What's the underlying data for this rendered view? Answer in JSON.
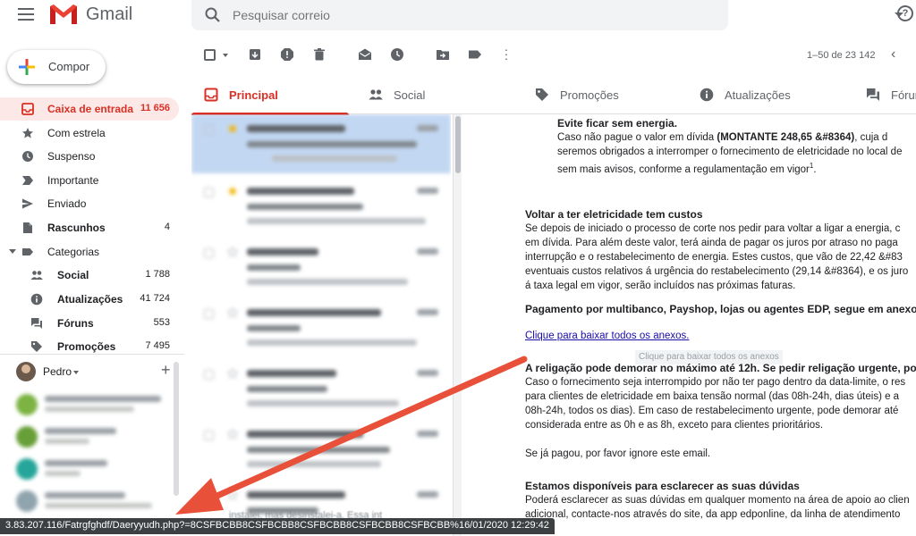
{
  "app": {
    "name": "Gmail"
  },
  "search": {
    "placeholder": "Pesquisar correio"
  },
  "sidebar": {
    "compose_label": "Compor",
    "items": [
      {
        "label": "Caixa de entrada",
        "count": "11 656",
        "icon": "inbox-icon",
        "active": true
      },
      {
        "label": "Com estrela",
        "count": "",
        "icon": "star-icon"
      },
      {
        "label": "Suspenso",
        "count": "",
        "icon": "clock-icon"
      },
      {
        "label": "Importante",
        "count": "",
        "icon": "important-icon"
      },
      {
        "label": "Enviado",
        "count": "",
        "icon": "send-icon"
      },
      {
        "label": "Rascunhos",
        "count": "4",
        "icon": "draft-icon",
        "bold": true
      },
      {
        "label": "Categorias",
        "count": "",
        "icon": "label-icon"
      }
    ],
    "categories": [
      {
        "label": "Social",
        "count": "1 788",
        "icon": "people-icon"
      },
      {
        "label": "Atualizações",
        "count": "41 724",
        "icon": "info-icon"
      },
      {
        "label": "Fóruns",
        "count": "553",
        "icon": "forum-icon"
      },
      {
        "label": "Promoções",
        "count": "7 495",
        "icon": "tag-icon"
      }
    ],
    "user": {
      "name": "Pedro"
    }
  },
  "toolbar": {
    "pager": "1–50 de 23 142"
  },
  "tabs": [
    {
      "label": "Principal",
      "icon": "inbox-icon",
      "active": true
    },
    {
      "label": "Social",
      "icon": "people-icon"
    },
    {
      "label": "Promoções",
      "icon": "tag-icon"
    },
    {
      "label": "Atualizações",
      "icon": "info-icon"
    },
    {
      "label": "Fóruns",
      "icon": "forum-icon"
    }
  ],
  "list": {
    "bottom_text": "instalei, mas desinstalei-a. Essa int"
  },
  "email": {
    "p1_title": "Evite ficar sem energia.",
    "p1_l1a": "Caso não pague o valor em dívida ",
    "p1_l1b": "(MONTANTE 248,65 &#8364)",
    "p1_l1c": ", cuja d",
    "p1_l2": "seremos obrigados a interromper o fornecimento de eletricidade no local de",
    "p1_l3": "sem mais avisos, conforme a regulamentação em vigor",
    "p1_sup": "1",
    "p2_title": "Voltar a ter eletricidade tem custos",
    "p2_l1": "Se depois de iniciado o processo de corte nos pedir para voltar a ligar a energia, c",
    "p2_l2": "em dívida. Para além deste valor, terá ainda de pagar os juros por atraso no paga",
    "p2_l3": "interrupção e o restabelecimento de energia. Estes custos, que vão de 22,42 &#83",
    "p2_l4": "eventuais custos relativos á urgência do restabelecimento (29,14 &#8364), e os juro",
    "p2_l5": "á taxa legal em vigor, serão incluídos nas próximas faturas.",
    "p3_title": "Pagamento por multibanco, Payshop, lojas ou agentes EDP, segue em anexo.",
    "link": "Clique para baixar todos os anexos.",
    "ghost": "Clique para baixar todos os anexos",
    "p4_title": "A religação pode demorar no máximo até 12h. Se pedir religação urgente, pode",
    "p4_l1": "Caso o fornecimento seja interrompido por não ter pago dentro da data-limite, o res",
    "p4_l2": "para clientes de eletricidade em baixa tensão normal (das 08h-24h, dias úteis) e a",
    "p4_l3": "08h-24h, todos os dias). Em caso de restabelecimento urgente, pode demorar até",
    "p4_l4": "considerada entre as 0h e as 8h, exceto para clientes prioritários.",
    "p5": "Se já pagou, por favor ignore este email.",
    "p6_title": "Estamos disponíveis para esclarecer as suas dúvidas",
    "p6_l1": "Poderá esclarecer as suas dúvidas em qualquer momento na área de apoio ao clien",
    "p6_l2": "adicional, contacte-nos através do site, da app edponline, da linha de atendimento"
  },
  "status_url": "3.83.207.116/Fatrgfghdf/Daeryyudh.php?=8CSFBCBB8CSFBCBB8CSFBCBB8CSFBCBB8CSFBCBB%16/01/2020 12:29:42",
  "colors": {
    "accent": "#d93025",
    "selected_row": "#c2d7f2",
    "link": "#1a0dab",
    "annotation_arrow": "#e8503a"
  }
}
